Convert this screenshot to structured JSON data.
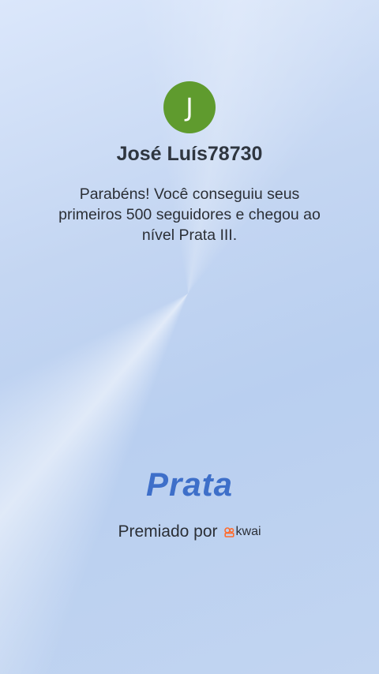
{
  "profile": {
    "avatar_initial": "J",
    "avatar_color": "#5f9b2e",
    "username": "José Luís78730"
  },
  "message": "Parabéns! Você conseguiu seus primeiros 500 seguidores e chegou ao nível Prata III.",
  "tier": {
    "name": "Prata",
    "color": "#3e6fc9"
  },
  "awarded": {
    "label": "Premiado por",
    "brand_name": "kwai",
    "brand_icon": "kwai-logo-icon",
    "brand_color": "#ff6b2c"
  }
}
